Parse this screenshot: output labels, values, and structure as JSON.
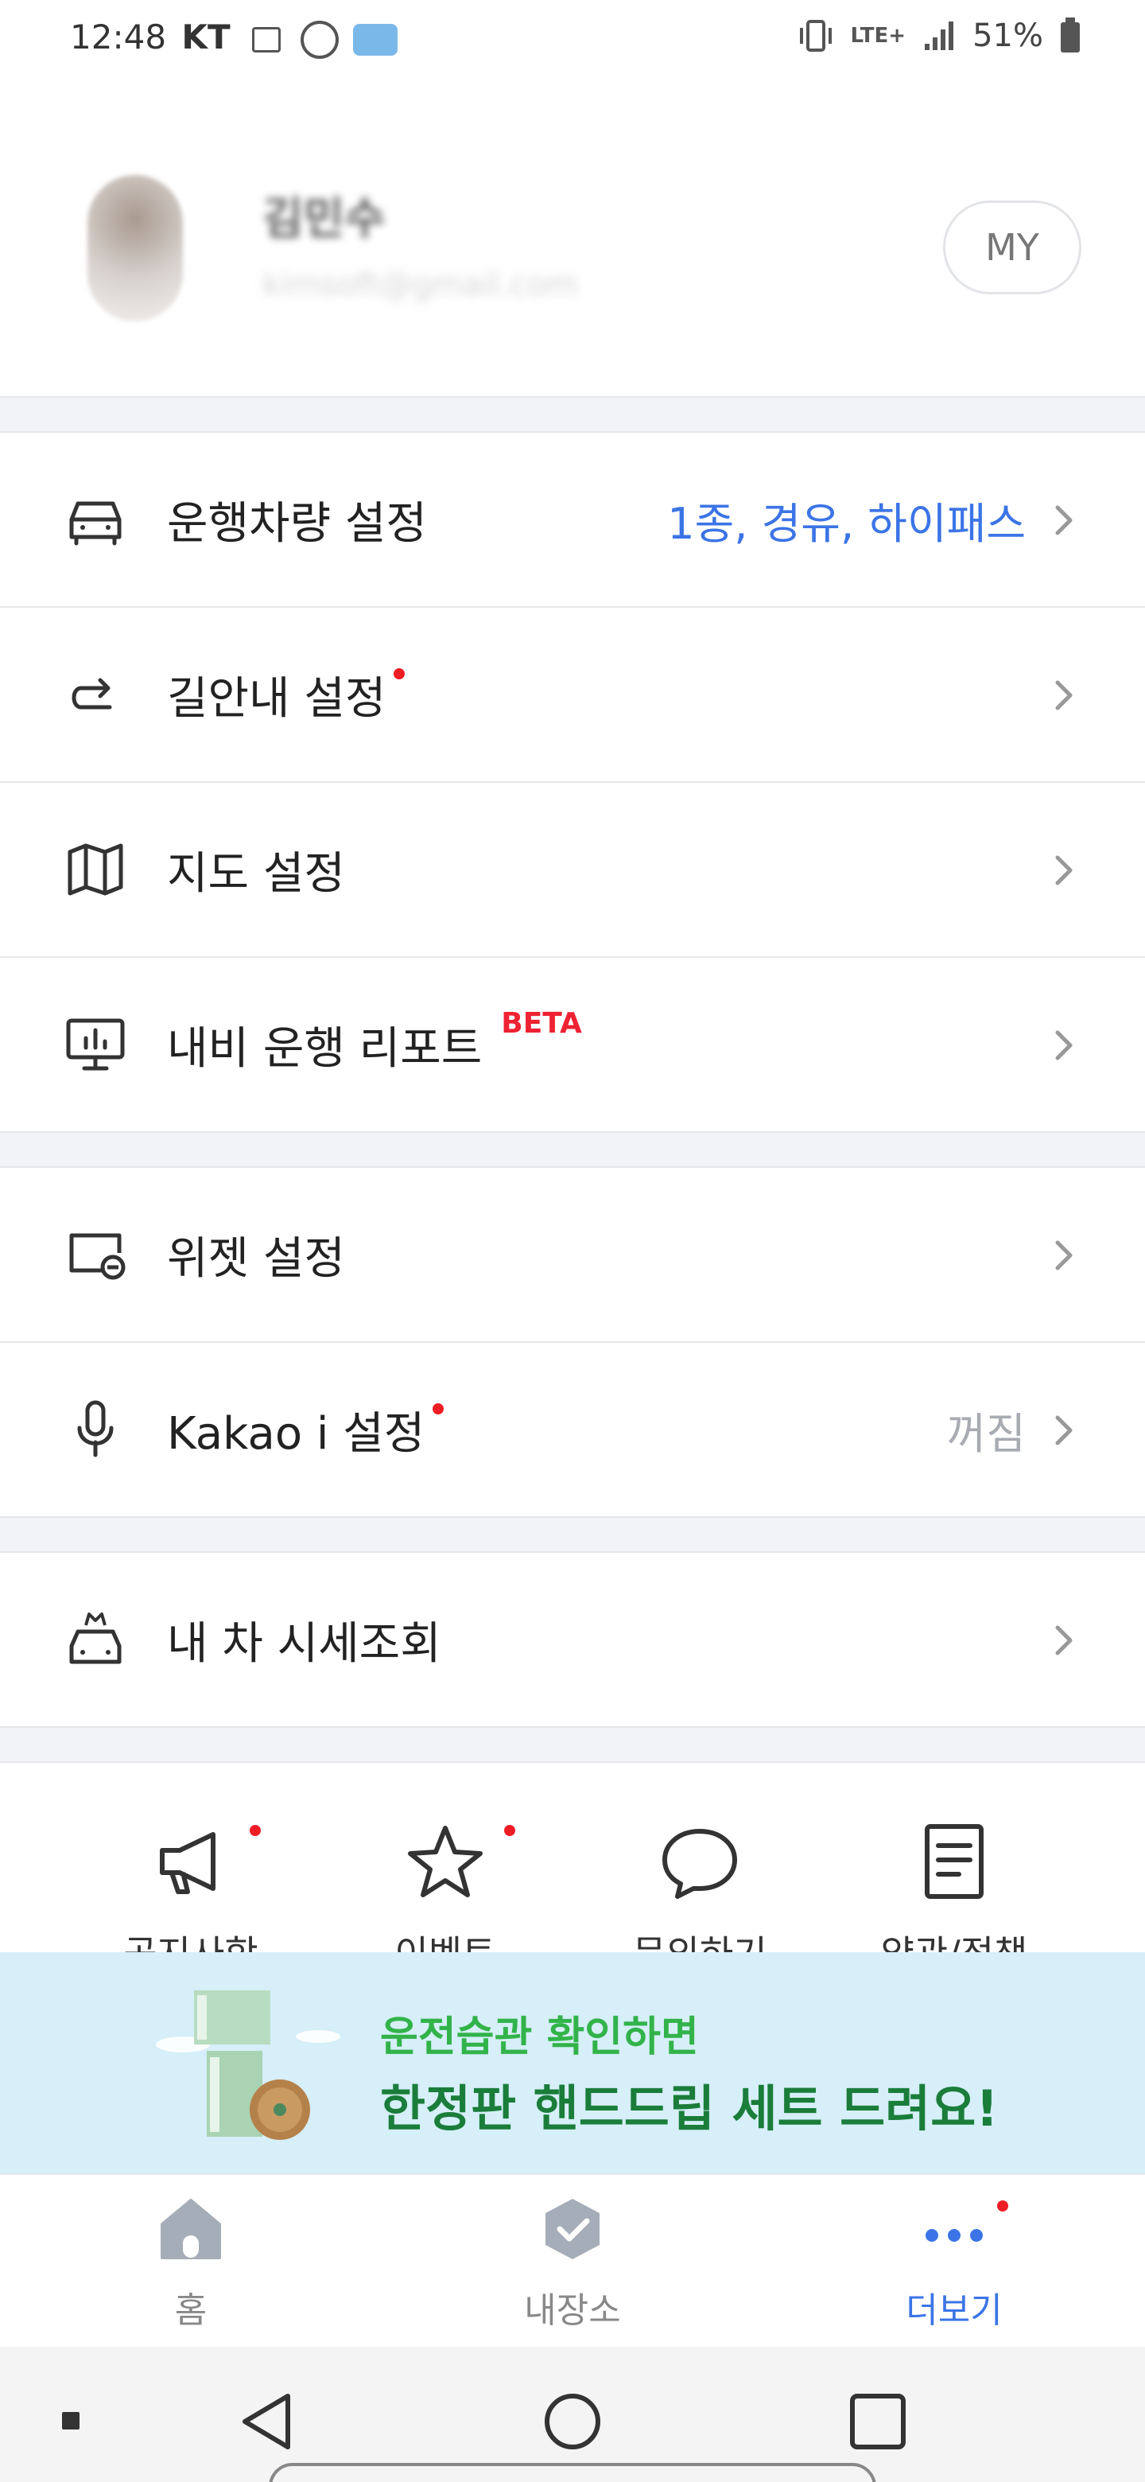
{
  "status_bar": {
    "time": "12:48",
    "carrier": "KT",
    "network": "LTE+",
    "battery": "51%"
  },
  "profile": {
    "name": "김민수",
    "email": "kimsoft@gmail.com",
    "my_button": "MY"
  },
  "menu": {
    "vehicle": {
      "label": "운행차량 설정",
      "value": "1종, 경유, 하이패스"
    },
    "route": {
      "label": "길안내 설정"
    },
    "map": {
      "label": "지도 설정"
    },
    "report": {
      "label": "내비 운행 리포트",
      "badge": "BETA"
    },
    "widget": {
      "label": "위젯 설정"
    },
    "kakao_i": {
      "label": "Kakao i 설정",
      "value": "꺼짐"
    },
    "car_price": {
      "label": "내 차 시세조회"
    }
  },
  "quick_menu": [
    {
      "label": "공지사항",
      "icon": "megaphone-icon"
    },
    {
      "label": "이벤트",
      "icon": "star-icon"
    },
    {
      "label": "문의하기",
      "icon": "chat-icon"
    },
    {
      "label": "약관/정책",
      "icon": "document-icon"
    }
  ],
  "banner": {
    "line1": "운전습관 확인하면",
    "line2": "한정판 핸드드립 세트 드려요!"
  },
  "bottom_nav": [
    {
      "label": "홈",
      "icon": "home-icon"
    },
    {
      "label": "내장소",
      "icon": "check-badge-icon"
    },
    {
      "label": "더보기",
      "icon": "more-dots-icon"
    }
  ],
  "colors": {
    "accent_blue": "#3b74e6",
    "red_dot": "#ee1c25",
    "banner_bg": "#d6eff9",
    "banner_green": "#32b34a"
  }
}
